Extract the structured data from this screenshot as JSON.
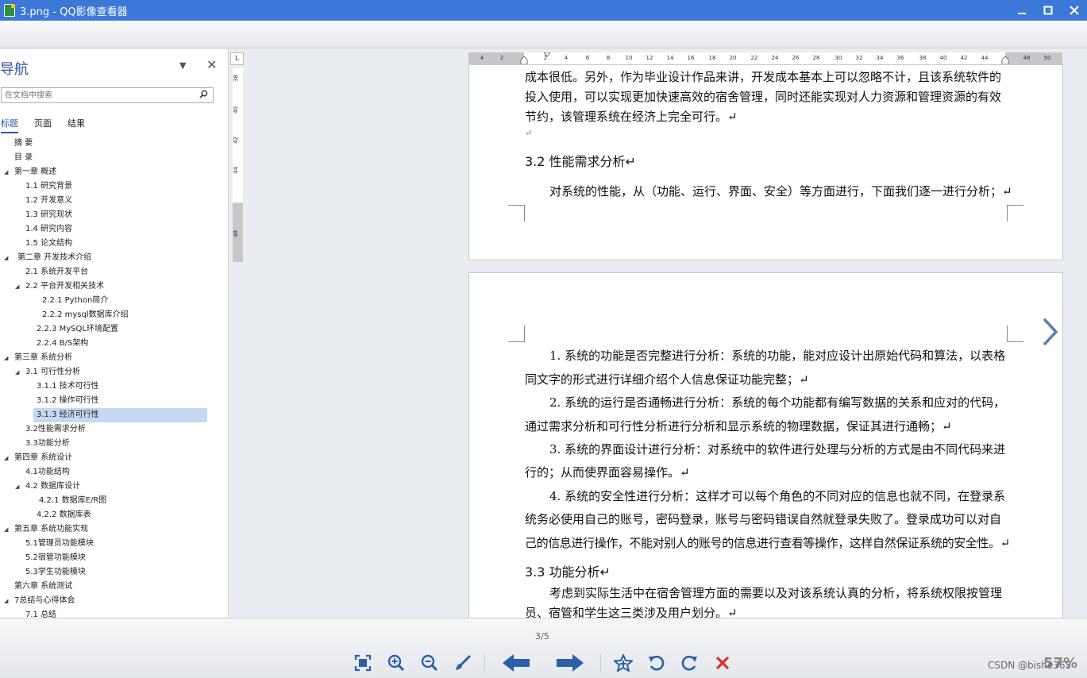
{
  "window": {
    "title": "3.png - QQ影像查看器"
  },
  "nav": {
    "header": "导航",
    "search_placeholder": "在文档中搜索",
    "tabs": [
      "标题",
      "页面",
      "结果"
    ],
    "tree": [
      {
        "label": "摘  要",
        "level": 0,
        "expanded": null
      },
      {
        "label": "目  录",
        "level": 0,
        "expanded": null
      },
      {
        "label": "第一章 概述",
        "level": 0,
        "expanded": true
      },
      {
        "label": "1.1 研究背景",
        "level": 1,
        "expanded": null
      },
      {
        "label": "1.2 开发意义",
        "level": 1,
        "expanded": null
      },
      {
        "label": "1.3 研究现状",
        "level": 1,
        "expanded": null
      },
      {
        "label": "1.4 研究内容",
        "level": 1,
        "expanded": null
      },
      {
        "label": "1.5 论文结构",
        "level": 1,
        "expanded": null
      },
      {
        "label": "第二章 开发技术介绍",
        "level": 0,
        "expanded": true
      },
      {
        "label": "2.1 系统开发平台",
        "level": 1,
        "expanded": null
      },
      {
        "label": "2.2 平台开发相关技术",
        "level": 1,
        "expanded": true
      },
      {
        "label": "2.2.1  Python简介",
        "level": 3,
        "expanded": null
      },
      {
        "label": "2.2.2  mysql数据库介绍",
        "level": 3,
        "expanded": null
      },
      {
        "label": "2.2.3  MySQL环境配置",
        "level": 2,
        "expanded": null
      },
      {
        "label": "2.2.4  B/S架构",
        "level": 2,
        "expanded": null
      },
      {
        "label": "第三章 系统分析",
        "level": 0,
        "expanded": true
      },
      {
        "label": "3.1 可行性分析",
        "level": 1,
        "expanded": true
      },
      {
        "label": "3.1.1 技术可行性",
        "level": 2,
        "expanded": null
      },
      {
        "label": "3.1.2 操作可行性",
        "level": 2,
        "expanded": null
      },
      {
        "label": "3.1.3 经济可行性",
        "level": 2,
        "expanded": null,
        "selected": true
      },
      {
        "label": "3.2性能需求分析",
        "level": 1,
        "expanded": null
      },
      {
        "label": "3.3功能分析",
        "level": 1,
        "expanded": null
      },
      {
        "label": "第四章 系统设计",
        "level": 0,
        "expanded": true
      },
      {
        "label": "4.1功能结构",
        "level": 1,
        "expanded": null
      },
      {
        "label": "4.2 数据库设计",
        "level": 1,
        "expanded": true
      },
      {
        "label": "4.2.1 数据库E/R图",
        "level": 2,
        "expanded": null
      },
      {
        "label": "4.2.2 数据库表",
        "level": 2,
        "expanded": null
      },
      {
        "label": "第五章 系统功能实现",
        "level": 0,
        "expanded": true
      },
      {
        "label": "5.1管理员功能模块",
        "level": 1,
        "expanded": null
      },
      {
        "label": "5.2宿管功能模块",
        "level": 1,
        "expanded": null
      },
      {
        "label": "5.3学生功能模块",
        "level": 1,
        "expanded": null
      },
      {
        "label": "第六章 系统测试",
        "level": 0,
        "expanded": null
      },
      {
        "label": "7总结与心得体会",
        "level": 0,
        "expanded": true
      },
      {
        "label": "7.1 总结",
        "level": 1,
        "expanded": null
      }
    ]
  },
  "ruler": {
    "corner": "L",
    "h_labels": [
      "4",
      "2",
      "2",
      "4",
      "6",
      "8",
      "10",
      "12",
      "14",
      "16",
      "18",
      "20",
      "22",
      "24",
      "26",
      "28",
      "30",
      "32",
      "34",
      "36",
      "38",
      "40",
      "42",
      "44",
      "48",
      "50"
    ],
    "v_labels": [
      "38",
      "40",
      "42",
      "44",
      "48"
    ]
  },
  "page1": {
    "lines": [
      "成本很低。另外，作为毕业设计作品来讲，开发成本基本上可以忽略不计，且该系统软件的",
      "投入使用，可以实现更加快速高效的宿舍管理，同时还能实现对人力资源和管理资源的有效",
      "节约，该管理系统在经济上完全可行。↵",
      "↵"
    ],
    "heading": "3.2 性能需求分析↵",
    "para": "对系统的性能，从（功能、运行、界面、安全）等方面进行，下面我们逐一进行分析；↵"
  },
  "page2": {
    "lines": [
      "1.  系统的功能是否完整进行分析：系统的功能，能对应设计出原始代码和算法，以表格",
      "同文字的形式进行详细介绍个人信息保证功能完整；↵",
      "2.  系统的运行是否通畅进行分析：系统的每个功能都有编写数据的关系和应对的代码，",
      "通过需求分析和可行性分析进行分析和显示系统的物理数据，保证其进行通畅；↵",
      "3.  系统的界面设计进行分析：对系统中的软件进行处理与分析的方式是由不同代码来进",
      "行的；从而使界面容易操作。↵",
      "4.  系统的安全性进行分析：这样才可以每个角色的不同对应的信息也就不同，在登录系",
      "统务必使用自己的账号，密码登录，账号与密码错误自然就登录失败了。登录成功可以对自",
      "己的信息进行操作，不能对别人的账号的信息进行查看等操作，这样自然保证系统的安全性。↵"
    ],
    "heading": "3.3 功能分析↵",
    "para_lines": [
      "考虑到实际生活中在宿舍管理方面的需要以及对该系统认真的分析，将系统权限按管理",
      "员、宿管和学生这三类涉及用户划分。↵"
    ]
  },
  "status": {
    "page_indicator": "3/5",
    "watermark": "CSDN @bishe365",
    "zoom_value": "57%"
  },
  "toolbar_icons": [
    "fit-window-icon",
    "zoom-in-icon",
    "zoom-out-icon",
    "brush-icon",
    "prev-arrow-icon",
    "next-arrow-icon",
    "favorite-icon",
    "rotate-left-icon",
    "rotate-right-icon",
    "delete-icon"
  ],
  "colors": {
    "titlebar": "#3c78d8",
    "accent": "#2b579a",
    "selection": "#c6d8f2",
    "toolbar_icon": "#2b5fa8",
    "delete": "#d9342b"
  }
}
